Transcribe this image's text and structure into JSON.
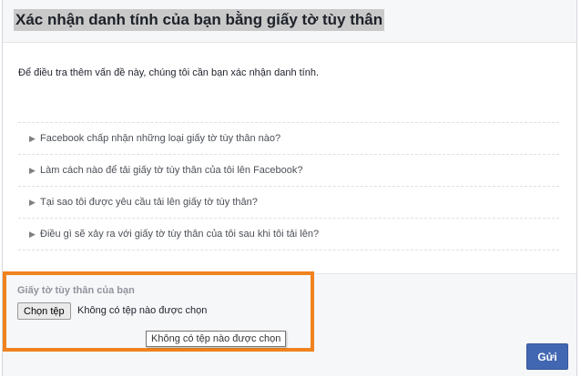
{
  "header": {
    "title": "Xác nhận danh tính của bạn bằng giấy tờ tùy thân"
  },
  "intro": "Để điều tra thêm vấn đề này, chúng tôi cần bạn xác nhận danh tính.",
  "faq": {
    "items": [
      "Facebook chấp nhận những loại giấy tờ tùy thân nào?",
      "Làm cách nào để tải giấy tờ tùy thân của tôi lên Facebook?",
      "Tại sao tôi được yêu cầu tải lên giấy tờ tùy thân?",
      "Điều gì sẽ xảy ra với giấy tờ tùy thân của tôi sau khi tôi tải lên?"
    ]
  },
  "upload": {
    "label": "Giấy tờ tùy thân của bạn",
    "choose_button": "Chọn tệp",
    "status": "Không có tệp nào được chọn",
    "tooltip": "Không có tệp nào được chọn"
  },
  "submit_label": "Gửi",
  "colors": {
    "highlight": "#f0831e",
    "submit_bg": "#4267b2"
  }
}
